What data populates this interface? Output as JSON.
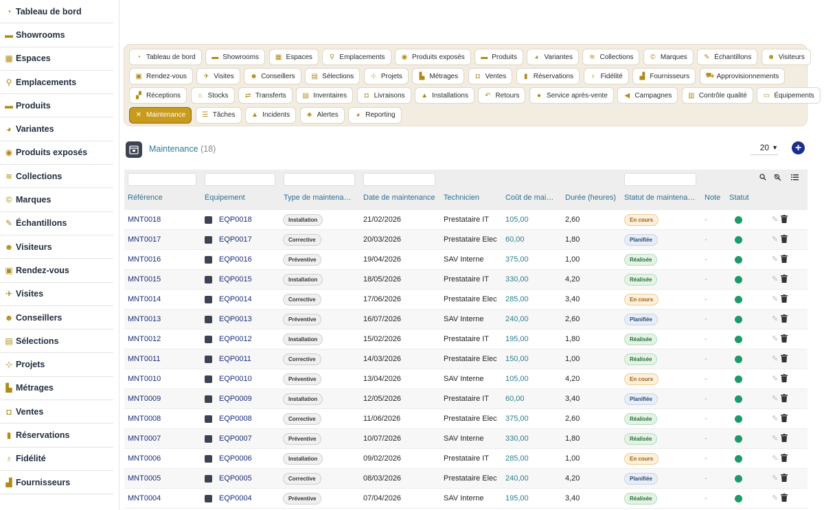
{
  "sidebar": {
    "items": [
      {
        "label": "Tableau de bord",
        "icon": "gauge-icon"
      },
      {
        "label": "Showrooms",
        "icon": "sofa-icon"
      },
      {
        "label": "Espaces",
        "icon": "grid-icon"
      },
      {
        "label": "Emplacements",
        "icon": "map-pin-icon"
      },
      {
        "label": "Produits",
        "icon": "sofa-icon"
      },
      {
        "label": "Variantes",
        "icon": "palette-icon"
      },
      {
        "label": "Produits exposés",
        "icon": "eye-icon"
      },
      {
        "label": "Collections",
        "icon": "layers-icon"
      },
      {
        "label": "Marques",
        "icon": "copyright-icon"
      },
      {
        "label": "Échantillons",
        "icon": "dropper-icon"
      },
      {
        "label": "Visiteurs",
        "icon": "users-icon"
      },
      {
        "label": "Rendez-vous",
        "icon": "calendar-check-icon"
      },
      {
        "label": "Visites",
        "icon": "walking-icon"
      },
      {
        "label": "Conseillers",
        "icon": "user-tie-icon"
      },
      {
        "label": "Sélections",
        "icon": "clipboard-list-icon"
      },
      {
        "label": "Projets",
        "icon": "diagram-icon"
      },
      {
        "label": "Métrages",
        "icon": "ruler-icon"
      },
      {
        "label": "Ventes",
        "icon": "truck-icon"
      },
      {
        "label": "Réservations",
        "icon": "bookmark-icon"
      },
      {
        "label": "Fidélité",
        "icon": "award-icon"
      },
      {
        "label": "Fournisseurs",
        "icon": "industry-icon"
      }
    ]
  },
  "tabs": [
    [
      {
        "label": "Tableau de bord",
        "icon": "gauge-icon",
        "glyph": "◔"
      },
      {
        "label": "Showrooms",
        "icon": "sofa-icon",
        "glyph": "▬"
      },
      {
        "label": "Espaces",
        "icon": "grid-icon",
        "glyph": "▦"
      },
      {
        "label": "Emplacements",
        "icon": "map-pin-icon",
        "glyph": "⚲"
      },
      {
        "label": "Produits exposés",
        "icon": "eye-icon",
        "glyph": "◉"
      },
      {
        "label": "Produits",
        "icon": "sofa-icon",
        "glyph": "▬"
      },
      {
        "label": "Variantes",
        "icon": "palette-icon",
        "glyph": "◕"
      },
      {
        "label": "Collections",
        "icon": "layers-icon",
        "glyph": "≋"
      },
      {
        "label": "Marques",
        "icon": "copyright-icon",
        "glyph": "©"
      },
      {
        "label": "Échantillons",
        "icon": "dropper-icon",
        "glyph": "✎"
      },
      {
        "label": "Visiteurs",
        "icon": "users-icon",
        "glyph": "☻"
      }
    ],
    [
      {
        "label": "Rendez-vous",
        "icon": "calendar-check-icon",
        "glyph": "▣"
      },
      {
        "label": "Visites",
        "icon": "walking-icon",
        "glyph": "✈"
      },
      {
        "label": "Conseillers",
        "icon": "user-tie-icon",
        "glyph": "☻"
      },
      {
        "label": "Sélections",
        "icon": "clipboard-list-icon",
        "glyph": "▤"
      },
      {
        "label": "Projets",
        "icon": "diagram-icon",
        "glyph": "⊹"
      },
      {
        "label": "Métrages",
        "icon": "ruler-icon",
        "glyph": "▙"
      },
      {
        "label": "Ventes",
        "icon": "truck-icon",
        "glyph": "◘"
      },
      {
        "label": "Réservations",
        "icon": "bookmark-icon",
        "glyph": "▮"
      },
      {
        "label": "Fidélité",
        "icon": "award-icon",
        "glyph": "♁"
      },
      {
        "label": "Fournisseurs",
        "icon": "industry-icon",
        "glyph": "▟"
      },
      {
        "label": "Approvisionnements",
        "icon": "cart-icon",
        "glyph": "⛟"
      }
    ],
    [
      {
        "label": "Réceptions",
        "icon": "truck-loading-icon",
        "glyph": "▞"
      },
      {
        "label": "Stocks",
        "icon": "warehouse-icon",
        "glyph": "⌂"
      },
      {
        "label": "Transferts",
        "icon": "arrows-icon",
        "glyph": "⇄"
      },
      {
        "label": "Inventaires",
        "icon": "clipboard-check-icon",
        "glyph": "▤"
      },
      {
        "label": "Livraisons",
        "icon": "truck-icon",
        "glyph": "◘"
      },
      {
        "label": "Installations",
        "icon": "tools-icon",
        "glyph": "▲"
      },
      {
        "label": "Retours",
        "icon": "undo-icon",
        "glyph": "↶"
      },
      {
        "label": "Service après-vente",
        "icon": "comment-icon",
        "glyph": "●"
      },
      {
        "label": "Campagnes",
        "icon": "bullhorn-icon",
        "glyph": "◀"
      },
      {
        "label": "Contrôle qualité",
        "icon": "clipboard-icon",
        "glyph": "▥"
      },
      {
        "label": "Équipements",
        "icon": "monitor-icon",
        "glyph": "▭"
      }
    ],
    [
      {
        "label": "Maintenance",
        "icon": "wrench-icon",
        "glyph": "✕",
        "active": true
      },
      {
        "label": "Tâches",
        "icon": "list-icon",
        "glyph": "☰"
      },
      {
        "label": "Incidents",
        "icon": "warning-icon",
        "glyph": "▲"
      },
      {
        "label": "Alertes",
        "icon": "bell-icon",
        "glyph": "♣"
      },
      {
        "label": "Reporting",
        "icon": "pie-chart-icon",
        "glyph": "◕"
      }
    ]
  ],
  "header": {
    "title": "Maintenance",
    "count": "(18)",
    "per_page": "20"
  },
  "columns": [
    "Référence",
    "Équipement",
    "Type de maintenance",
    "Date de maintenance",
    "Technicien",
    "Coût de maintenance",
    "Durée (heures)",
    "Statut de maintenance",
    "Note",
    "Statut"
  ],
  "rows": [
    {
      "ref": "MNT0018",
      "eq": "EQP0018",
      "type": "Installation",
      "date": "21/02/2026",
      "tech": "Prestataire IT",
      "cost": "105,00",
      "dur": "2,60",
      "status": "En cours",
      "note": "-"
    },
    {
      "ref": "MNT0017",
      "eq": "EQP0017",
      "type": "Corrective",
      "date": "20/03/2026",
      "tech": "Prestataire Elec",
      "cost": "60,00",
      "dur": "1,80",
      "status": "Planifiée",
      "note": "-"
    },
    {
      "ref": "MNT0016",
      "eq": "EQP0016",
      "type": "Préventive",
      "date": "19/04/2026",
      "tech": "SAV Interne",
      "cost": "375,00",
      "dur": "1,00",
      "status": "Réalisée",
      "note": "-"
    },
    {
      "ref": "MNT0015",
      "eq": "EQP0015",
      "type": "Installation",
      "date": "18/05/2026",
      "tech": "Prestataire IT",
      "cost": "330,00",
      "dur": "4,20",
      "status": "Réalisée",
      "note": "-"
    },
    {
      "ref": "MNT0014",
      "eq": "EQP0014",
      "type": "Corrective",
      "date": "17/06/2026",
      "tech": "Prestataire Elec",
      "cost": "285,00",
      "dur": "3,40",
      "status": "En cours",
      "note": "-"
    },
    {
      "ref": "MNT0013",
      "eq": "EQP0013",
      "type": "Préventive",
      "date": "16/07/2026",
      "tech": "SAV Interne",
      "cost": "240,00",
      "dur": "2,60",
      "status": "Planifiée",
      "note": "-"
    },
    {
      "ref": "MNT0012",
      "eq": "EQP0012",
      "type": "Installation",
      "date": "15/02/2026",
      "tech": "Prestataire IT",
      "cost": "195,00",
      "dur": "1,80",
      "status": "Réalisée",
      "note": "-"
    },
    {
      "ref": "MNT0011",
      "eq": "EQP0011",
      "type": "Corrective",
      "date": "14/03/2026",
      "tech": "Prestataire Elec",
      "cost": "150,00",
      "dur": "1,00",
      "status": "Réalisée",
      "note": "-"
    },
    {
      "ref": "MNT0010",
      "eq": "EQP0010",
      "type": "Préventive",
      "date": "13/04/2026",
      "tech": "SAV Interne",
      "cost": "105,00",
      "dur": "4,20",
      "status": "En cours",
      "note": "-"
    },
    {
      "ref": "MNT0009",
      "eq": "EQP0009",
      "type": "Installation",
      "date": "12/05/2026",
      "tech": "Prestataire IT",
      "cost": "60,00",
      "dur": "3,40",
      "status": "Planifiée",
      "note": "-"
    },
    {
      "ref": "MNT0008",
      "eq": "EQP0008",
      "type": "Corrective",
      "date": "11/06/2026",
      "tech": "Prestataire Elec",
      "cost": "375,00",
      "dur": "2,60",
      "status": "Réalisée",
      "note": "-"
    },
    {
      "ref": "MNT0007",
      "eq": "EQP0007",
      "type": "Préventive",
      "date": "10/07/2026",
      "tech": "SAV Interne",
      "cost": "330,00",
      "dur": "1,80",
      "status": "Réalisée",
      "note": "-"
    },
    {
      "ref": "MNT0006",
      "eq": "EQP0006",
      "type": "Installation",
      "date": "09/02/2026",
      "tech": "Prestataire IT",
      "cost": "285,00",
      "dur": "1,00",
      "status": "En cours",
      "note": "-"
    },
    {
      "ref": "MNT0005",
      "eq": "EQP0005",
      "type": "Corrective",
      "date": "08/03/2026",
      "tech": "Prestataire Elec",
      "cost": "240,00",
      "dur": "4,20",
      "status": "Planifiée",
      "note": "-"
    },
    {
      "ref": "MNT0004",
      "eq": "EQP0004",
      "type": "Préventive",
      "date": "07/04/2026",
      "tech": "SAV Interne",
      "cost": "195,00",
      "dur": "3,40",
      "status": "Réalisée",
      "note": "-"
    }
  ],
  "colors": {
    "accent": "#c99b1c",
    "link": "#1a2c7a",
    "status_active": "#1e9a6a"
  }
}
